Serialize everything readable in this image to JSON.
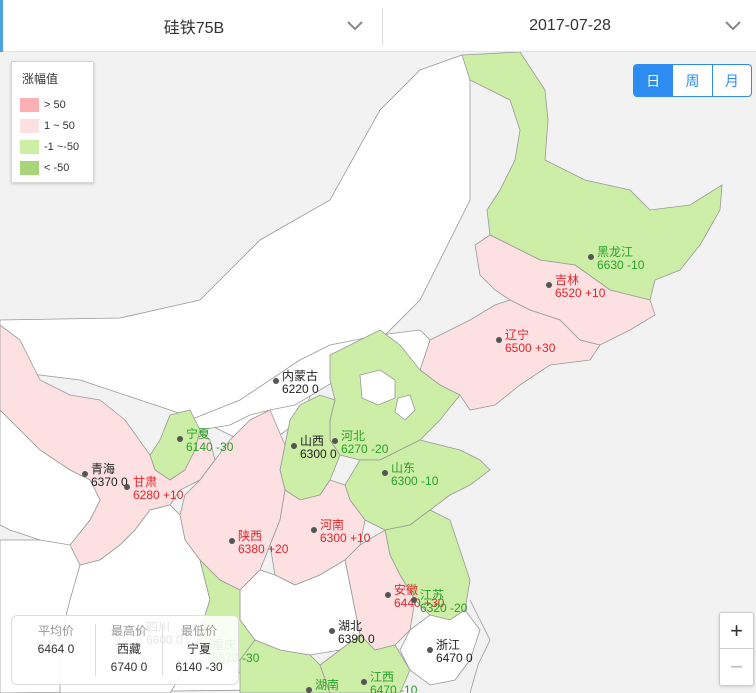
{
  "selectors": {
    "product": "硅铁75B",
    "date": "2017-07-28"
  },
  "legend": {
    "title": "涨幅值",
    "items": [
      {
        "label": "> 50",
        "color": "#fdb0b4"
      },
      {
        "label": "1 ~ 50",
        "color": "#fde0e2"
      },
      {
        "label": "-1 ~-50",
        "color": "#cdeea6"
      },
      {
        "label": "< -50",
        "color": "#a8d47c"
      }
    ]
  },
  "period": {
    "day": "日",
    "week": "周",
    "month": "月",
    "active": "day"
  },
  "zoom": {
    "in": "+",
    "out": "−"
  },
  "stats": {
    "avg_label": "平均价",
    "avg_value": "6464 0",
    "max_label": "最高价",
    "max_name": "西藏",
    "max_value": "6740 0",
    "min_label": "最低价",
    "min_name": "宁夏",
    "min_value": "6140 -30"
  },
  "provinces": [
    {
      "name": "黑龙江",
      "value": "6630 -10",
      "status": "down"
    },
    {
      "name": "吉林",
      "value": "6520 +10",
      "status": "up"
    },
    {
      "name": "辽宁",
      "value": "6500 +30",
      "status": "up"
    },
    {
      "name": "内蒙古",
      "value": "6220 0",
      "status": "flat"
    },
    {
      "name": "山西",
      "value": "6300 0",
      "status": "flat"
    },
    {
      "name": "河北",
      "value": "6270 -20",
      "status": "down"
    },
    {
      "name": "山东",
      "value": "6300 -10",
      "status": "down"
    },
    {
      "name": "宁夏",
      "value": "6140 -30",
      "status": "down"
    },
    {
      "name": "青海",
      "value": "6370 0",
      "status": "flat"
    },
    {
      "name": "甘肃",
      "value": "6280 +10",
      "status": "up"
    },
    {
      "name": "陕西",
      "value": "6380 +20",
      "status": "up"
    },
    {
      "name": "河南",
      "value": "6300 +10",
      "status": "up"
    },
    {
      "name": "安徽",
      "value": "6440 +30",
      "status": "up"
    },
    {
      "name": "江苏",
      "value": "6320 -20",
      "status": "down"
    },
    {
      "name": "湖北",
      "value": "6390 0",
      "status": "flat"
    },
    {
      "name": "浙江",
      "value": "6470 0",
      "status": "flat"
    },
    {
      "name": "江西",
      "value": "6470 -10",
      "status": "down"
    },
    {
      "name": "四川",
      "value": "6600 0",
      "status": "flat"
    },
    {
      "name": "重庆",
      "value": "6570 -30",
      "status": "down"
    },
    {
      "name": "湖南",
      "value": "",
      "status": "down"
    }
  ]
}
